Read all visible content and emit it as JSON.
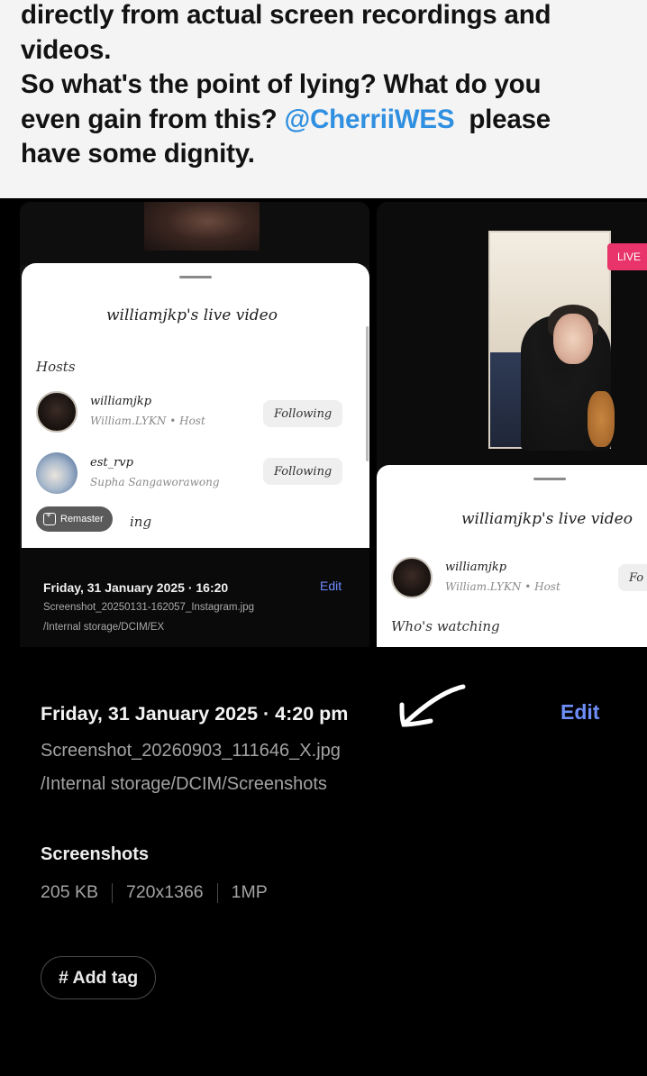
{
  "tweet": {
    "line1": "directly from actual screen recordings and",
    "line2": "videos.",
    "line3": "So what's the point of lying? What do you",
    "line4_prefix": "even gain from this?",
    "mention": "@CherriiWES",
    "line4_suffix": "please",
    "line5": "have some dignity."
  },
  "left_screenshot": {
    "sheet_title": "williamjkp's live video",
    "hosts_label": "Hosts",
    "hosts": [
      {
        "username": "williamjkp",
        "fullname": "William.LYKN • Host",
        "button": "Following"
      },
      {
        "username": "est_rvp",
        "fullname": "Supha Sangaworawong",
        "button": "Following"
      }
    ],
    "remaster_label": "Remaster",
    "cut_text": "ing",
    "info": {
      "date": "Friday, 31 January 2025 · 16:20",
      "edit": "Edit",
      "filename": "Screenshot_20250131-162057_Instagram.jpg",
      "path": "/Internal storage/DCIM/EX"
    }
  },
  "right_screenshot": {
    "live_badge": "LIVE",
    "sheet_title": "williamjkp's live video",
    "host": {
      "username": "williamjkp",
      "fullname": "William.LYKN • Host",
      "button": "Fo"
    },
    "watching_label": "Who's watching"
  },
  "info": {
    "date": "Friday, 31 January 2025 · 4:20 pm",
    "edit": "Edit",
    "filename": "Screenshot_20260903_111646_X.jpg",
    "path": "/Internal storage/DCIM/Screenshots",
    "album": "Screenshots",
    "size": "205 KB",
    "resolution": "720x1366",
    "megapixels": "1MP",
    "add_tag": "# Add tag"
  },
  "colors": {
    "mention": "#2f8fe0",
    "edit_link": "#6e8ef7",
    "live_badge": "#e8346a"
  }
}
